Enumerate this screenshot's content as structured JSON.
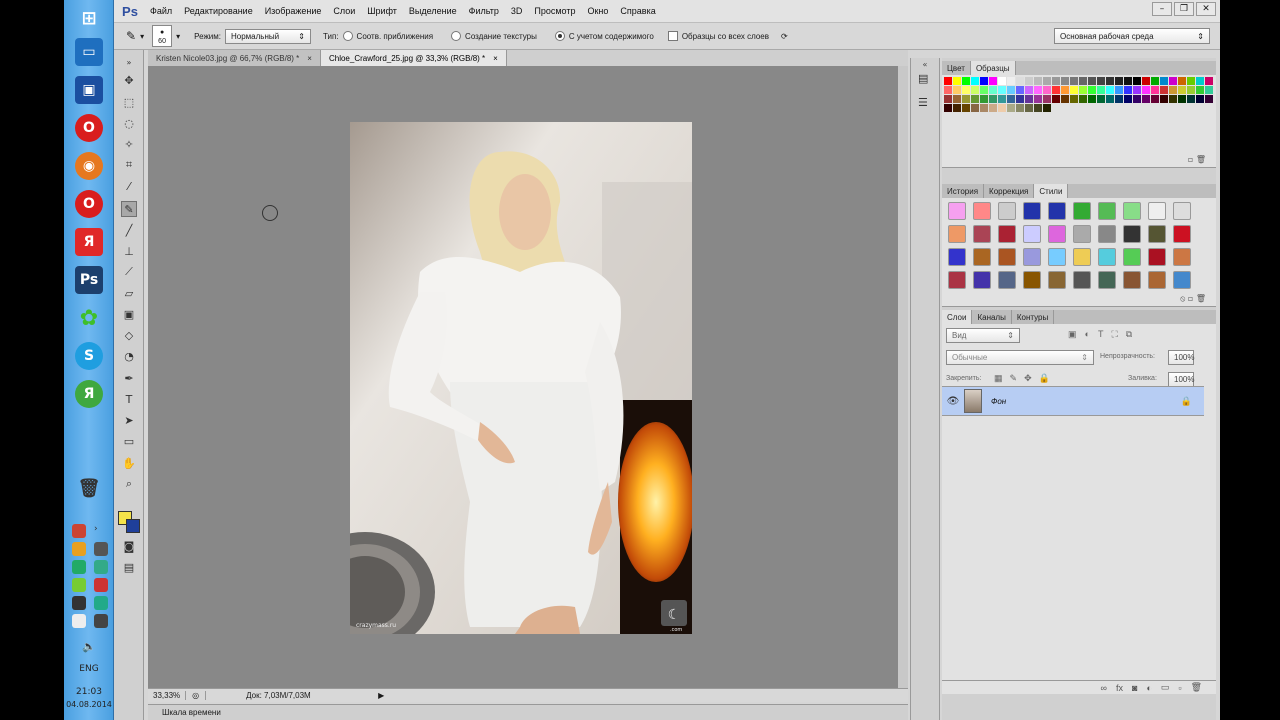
{
  "taskbar": {
    "icons": [
      "windows-start",
      "desktop",
      "save",
      "opera",
      "firefox",
      "opera-2",
      "yandex",
      "photoshop",
      "icq",
      "skype",
      "yandex-2"
    ],
    "lang": "ENG",
    "time": "21:03",
    "date": "04.08.2014"
  },
  "app": {
    "logo": "Ps",
    "menu": [
      "Файл",
      "Редактирование",
      "Изображение",
      "Слои",
      "Шрифт",
      "Выделение",
      "Фильтр",
      "3D",
      "Просмотр",
      "Окно",
      "Справка"
    ],
    "window_controls": [
      "–",
      "❐",
      "✕"
    ]
  },
  "options": {
    "brush_size": "60",
    "mode_label": "Режим:",
    "mode_value": "Нормальный",
    "type_label": "Тип:",
    "type_options": [
      "Соотв. приближения",
      "Создание текстуры",
      "С учетом содержимого"
    ],
    "type_selected": 2,
    "sample_all_label": "Образцы со всех слоев",
    "workspace": "Основная рабочая среда"
  },
  "tabs": [
    {
      "label": "Kristen Nicole03.jpg @ 66,7% (RGB/8) *",
      "active": false
    },
    {
      "label": "Chloe_Crawford_25.jpg @ 33,3% (RGB/8) *",
      "active": true
    }
  ],
  "photo": {
    "watermark_text": "crazymass.ru",
    "corner_label": ".com"
  },
  "status": {
    "zoom": "33,33%",
    "doc": "Док: 7,03M/7,03M"
  },
  "timeline_label": "Шкала времени",
  "swatches_panel": {
    "tabs": [
      "Цвет",
      "Образцы"
    ],
    "active": 1
  },
  "styles_panel": {
    "tabs": [
      "История",
      "Коррекция",
      "Стили"
    ],
    "active": 2
  },
  "layers_panel": {
    "tabs": [
      "Слои",
      "Каналы",
      "Контуры"
    ],
    "active": 0,
    "filter_label": "Вид",
    "blend_mode": "Обычные",
    "opacity_label": "Непрозрачность:",
    "opacity_value": "100%",
    "lock_label": "Закрепить:",
    "fill_label": "Заливка:",
    "fill_value": "100%",
    "layers": [
      {
        "name": "Фон",
        "locked": true,
        "visible": true
      }
    ]
  },
  "colors": {
    "foreground": "#f5e34a",
    "background": "#1f3f9a",
    "layer_highlight": "#b7cdf3"
  }
}
